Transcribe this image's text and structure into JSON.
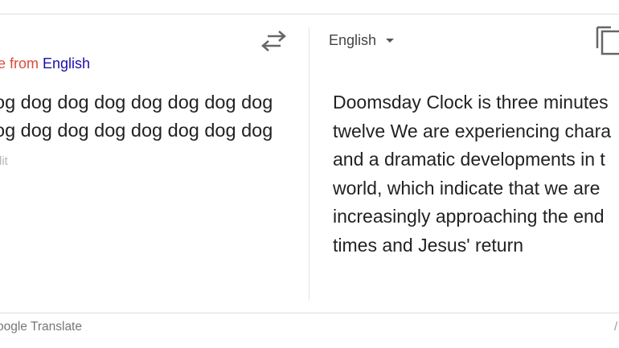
{
  "source": {
    "hint_prefix": "te from",
    "hint_language": "English",
    "lines": [
      "og dog dog dog dog dog dog dog",
      "og dog dog dog dog dog dog dog"
    ],
    "edit_label": "dit"
  },
  "target": {
    "language": "English",
    "lines": [
      "Doomsday Clock is three minutes",
      "twelve We are experiencing chara",
      "and a dramatic developments in t",
      "world, which indicate that we are",
      "increasingly approaching the end",
      "times and Jesus' return"
    ]
  },
  "footer": {
    "brand": "oogle Translate",
    "right_mark": "/"
  },
  "icons": {
    "swap": "swap-languages-icon",
    "copy": "copy-icon",
    "caret": "chevron-down-icon"
  },
  "colors": {
    "hint_prefix": "#dd4b39",
    "hint_language": "#1a0dab"
  }
}
